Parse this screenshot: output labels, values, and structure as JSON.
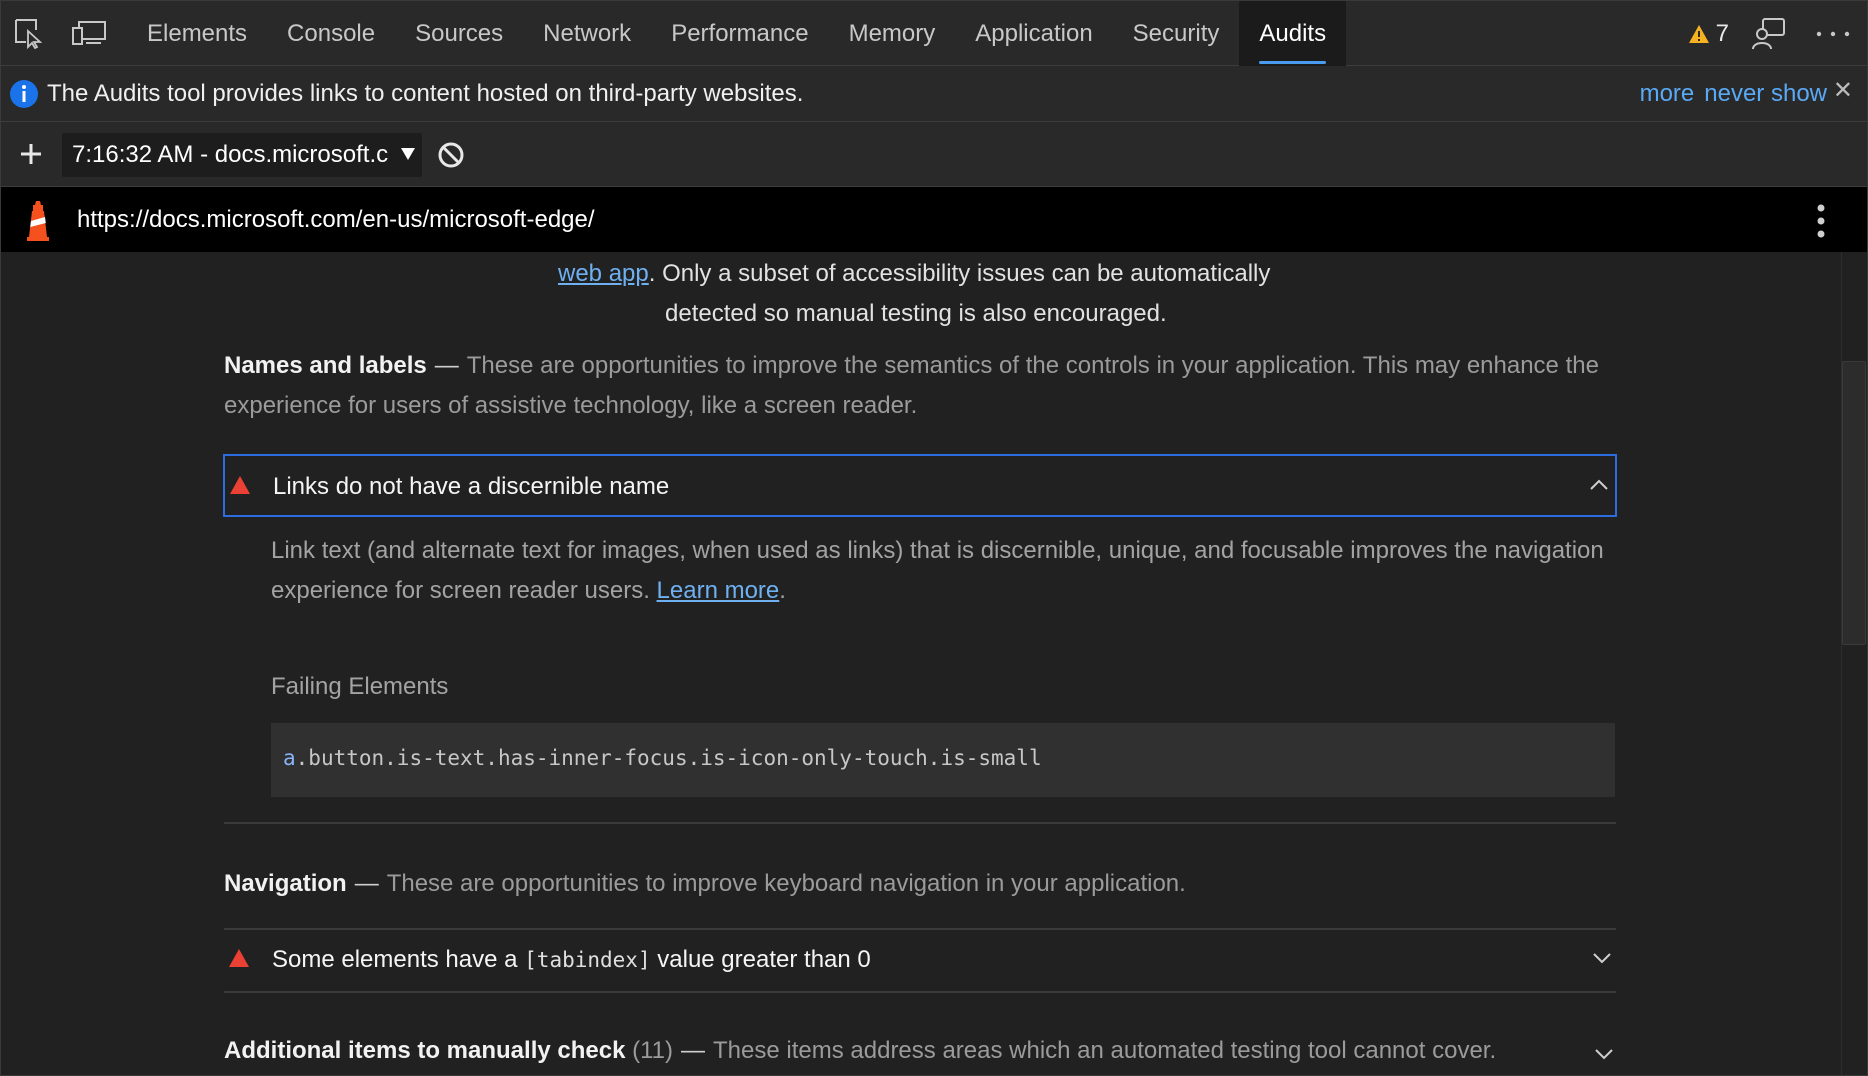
{
  "toolbar": {
    "tabs": [
      "Elements",
      "Console",
      "Sources",
      "Network",
      "Performance",
      "Memory",
      "Application",
      "Security",
      "Audits"
    ],
    "active_tab": "Audits",
    "warning_count": "7"
  },
  "infobar": {
    "message": "The Audits tool provides links to content hosted on third-party websites.",
    "more_label": "more",
    "never_show_label": "never show",
    "close_glyph": "✕"
  },
  "audit_bar": {
    "report_label": "7:16:32 AM - docs.microsoft.c"
  },
  "urlbar": {
    "url": "https://docs.microsoft.com/en-us/microsoft-edge/"
  },
  "content": {
    "intro": {
      "link_text": "web app",
      "line1_rest": ". Only a subset of accessibility issues can be automatically",
      "line2": "detected so manual testing is also encouraged."
    },
    "names_group": {
      "title": "Names and labels",
      "description": "These are opportunities to improve the semantics of the controls in your application. This may enhance the experience for users of assistive technology, like a screen reader."
    },
    "audit_links": {
      "title": "Links do not have a discernible name",
      "description": "Link text (and alternate text for images, when used as links) that is discernible, unique, and focusable improves the navigation experience for screen reader users.",
      "learn_more": "Learn more",
      "period": ".",
      "failing_label": "Failing Elements",
      "failing_tag": "a",
      "failing_selector": ".button.is-text.has-inner-focus.is-icon-only-touch.is-small"
    },
    "navigation_group": {
      "title": "Navigation",
      "description": "These are opportunities to improve keyboard navigation in your application."
    },
    "audit_tabindex": {
      "title_pre": "Some elements have a",
      "title_code": "[tabindex]",
      "title_post": "value greater than 0"
    },
    "manual_group": {
      "title": "Additional items to manually check",
      "count": "(11)",
      "description": "These items address areas which an automated testing tool cannot cover."
    }
  },
  "colors": {
    "accent": "#4a9cf0",
    "fail": "#eb4034",
    "warning": "#f5b323",
    "link": "#6fb0f0"
  }
}
